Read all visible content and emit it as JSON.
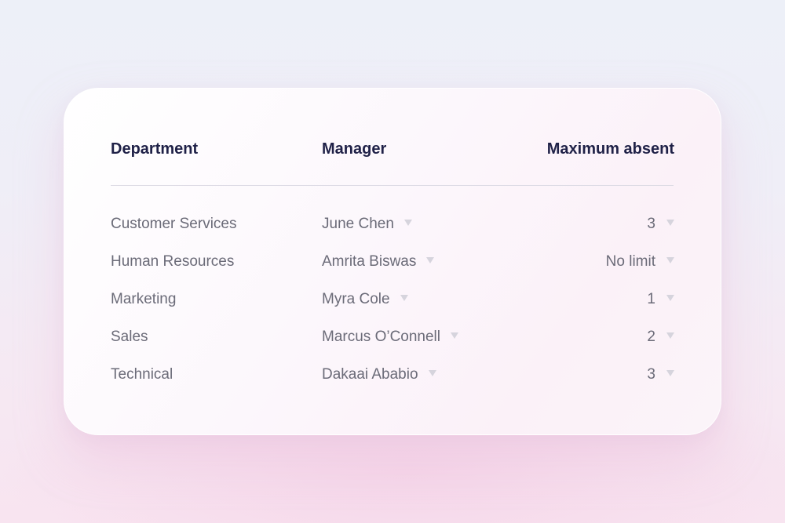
{
  "table": {
    "headers": {
      "department": "Department",
      "manager": "Manager",
      "max_absent": "Maximum absent"
    },
    "rows": [
      {
        "department": "Customer Services",
        "manager": "June Chen",
        "max_absent": "3"
      },
      {
        "department": "Human Resources",
        "manager": "Amrita Biswas",
        "max_absent": "No limit"
      },
      {
        "department": "Marketing",
        "manager": "Myra Cole",
        "max_absent": "1"
      },
      {
        "department": "Sales",
        "manager": "Marcus O’Connell",
        "max_absent": "2"
      },
      {
        "department": "Technical",
        "manager": "Dakaai Ababio",
        "max_absent": "3"
      }
    ]
  },
  "icons": {
    "dropdown": "chevron-down-icon"
  },
  "colors": {
    "header_text": "#1f2147",
    "body_text": "#6b6b78",
    "caret": "#d6d4dd",
    "divider": "#dcdae4",
    "card_background": "#ffffff",
    "page_background": "#efeef7"
  }
}
